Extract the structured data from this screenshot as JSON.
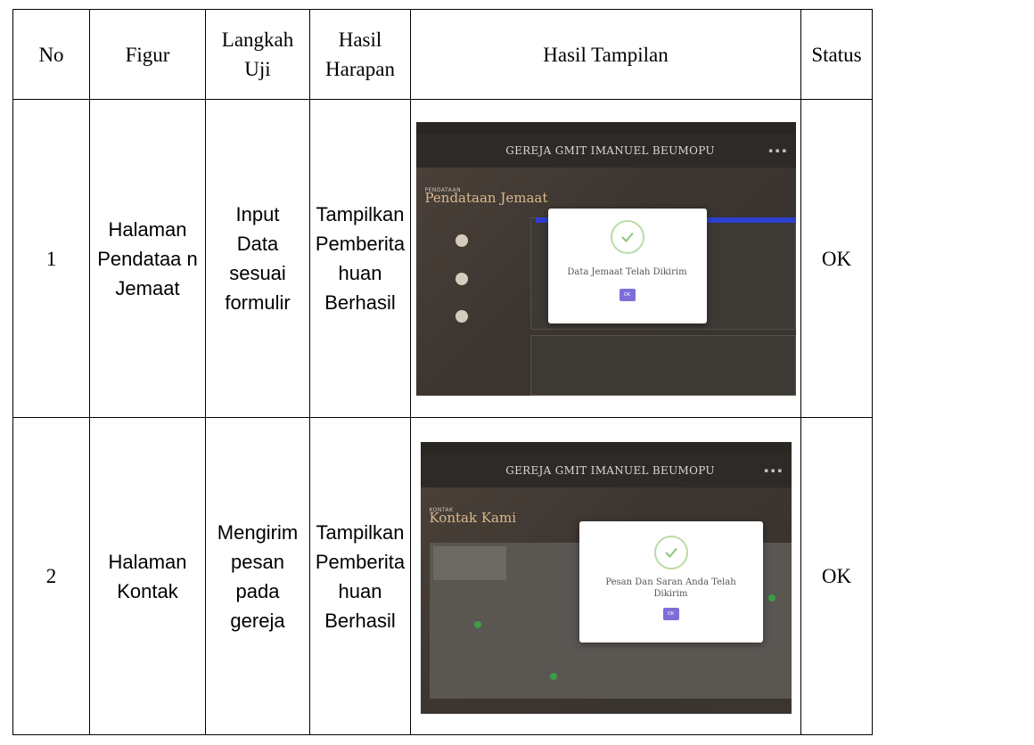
{
  "headers": {
    "no": "No",
    "figur": "Figur",
    "langkah": "Langkah Uji",
    "hasil_harapan": "Hasil Harapan",
    "hasil_tampilan": "Hasil Tampilan",
    "status": "Status"
  },
  "rows": [
    {
      "no": "1",
      "figur": "Halaman Pendataa n Jemaat",
      "langkah": "Input Data sesuai formulir",
      "hasil_harapan": "Tampilkan Pemberita huan Berhasil",
      "status": "OK",
      "shot": {
        "site_title": "GEREJA GMIT IMANUEL BEUMOPU",
        "page_tag": "PENDATAAN",
        "page_title": "Pendataan Jemaat",
        "modal_message": "Data Jemaat Telah Dikirim",
        "ok_label": "OK"
      }
    },
    {
      "no": "2",
      "figur": "Halaman Kontak",
      "langkah": "Mengirim pesan pada gereja",
      "hasil_harapan": "Tampilkan Pemberita huan Berhasil",
      "status": "OK",
      "shot": {
        "site_title": "GEREJA GMIT IMANUEL BEUMOPU",
        "page_tag": "KONTAK",
        "page_title": "Kontak Kami",
        "modal_message": "Pesan Dan Saran Anda Telah Dikirim",
        "ok_label": "OK"
      }
    }
  ],
  "colors": {
    "accent_ok": "#7d6fd9",
    "check": "#8fc47a",
    "hero_title": "#d9b98e"
  }
}
